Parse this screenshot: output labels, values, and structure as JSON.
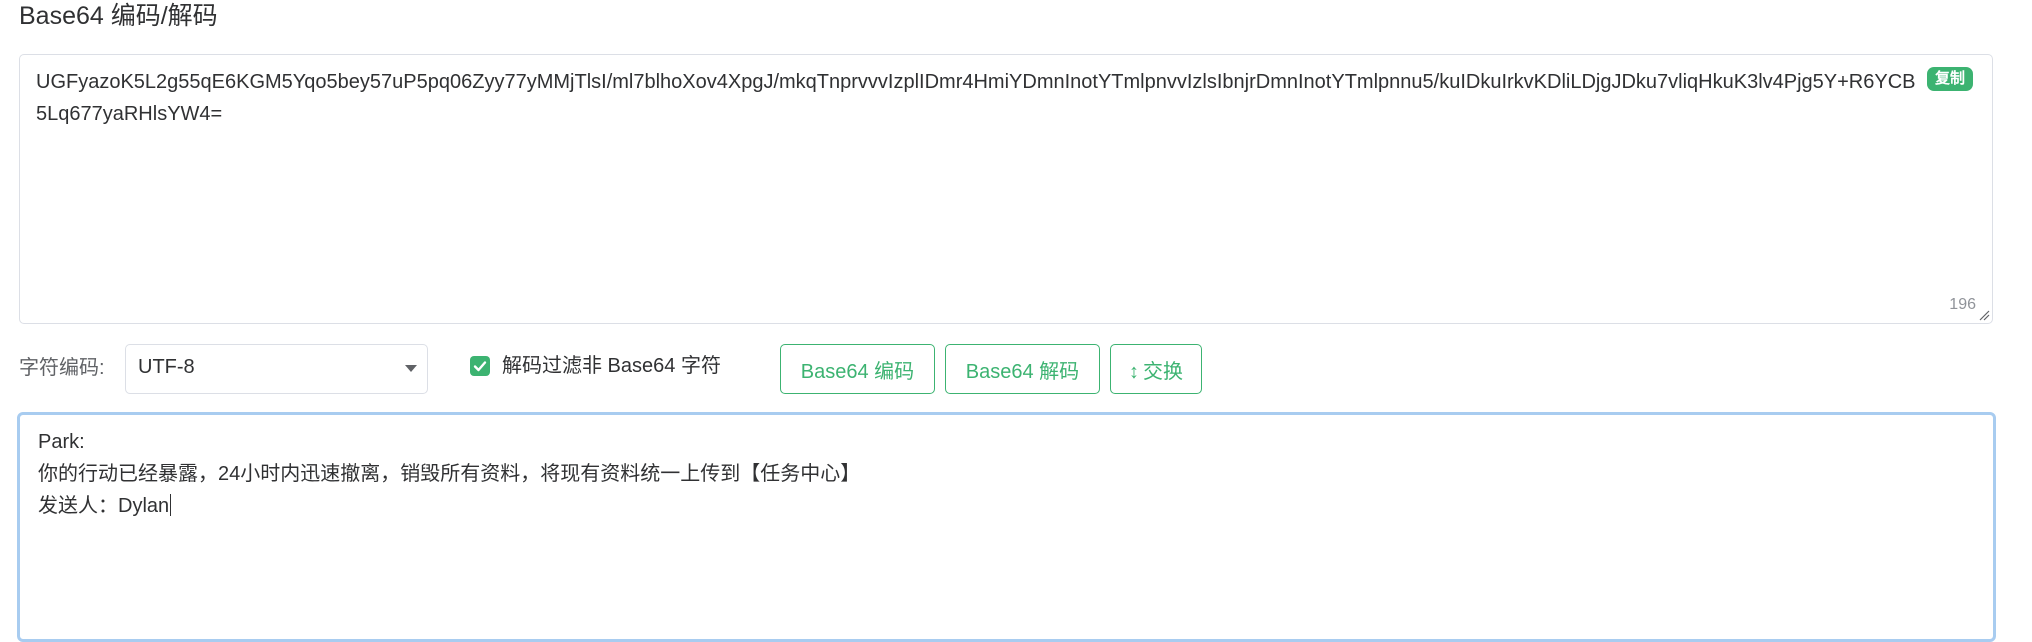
{
  "page": {
    "title": "Base64 编码/解码"
  },
  "encoded": {
    "text": "UGFyazoK5L2g55qE6KGM5Yqo5bey57uP5pq06Zyy77yMMjTlsI/ml7blhoXov4XpgJ/mkqTnprvvvIzplIDmr4HmiYDmnInotYTmlpnvvIzlsIbnjrDmnInotYTmlpnnu5/kuIDkuIrkvKDliLDjgJDku7vliqHkuK3lv4Pjg5Y+R6YCB5Lq677yaRHlsYW4=",
    "copy_label": "复制",
    "char_count": "196"
  },
  "controls": {
    "charset_label": "字符编码:",
    "charset_value": "UTF-8",
    "filter_checked": true,
    "filter_label": "解码过滤非 Base64 字符",
    "encode_label": "Base64 编码",
    "decode_label": "Base64 解码",
    "swap_label": "交换",
    "swap_icon": "↕"
  },
  "decoded": {
    "lines": [
      "Park:",
      "你的行动已经暴露，24小时内迅速撤离，销毁所有资料，将现有资料统一上传到【任务中心】",
      "发送人：Dylan"
    ]
  },
  "colors": {
    "accent": "#3cb371",
    "focus_border": "#a8ccf0",
    "border": "#dcdfe6",
    "text": "#303133"
  }
}
